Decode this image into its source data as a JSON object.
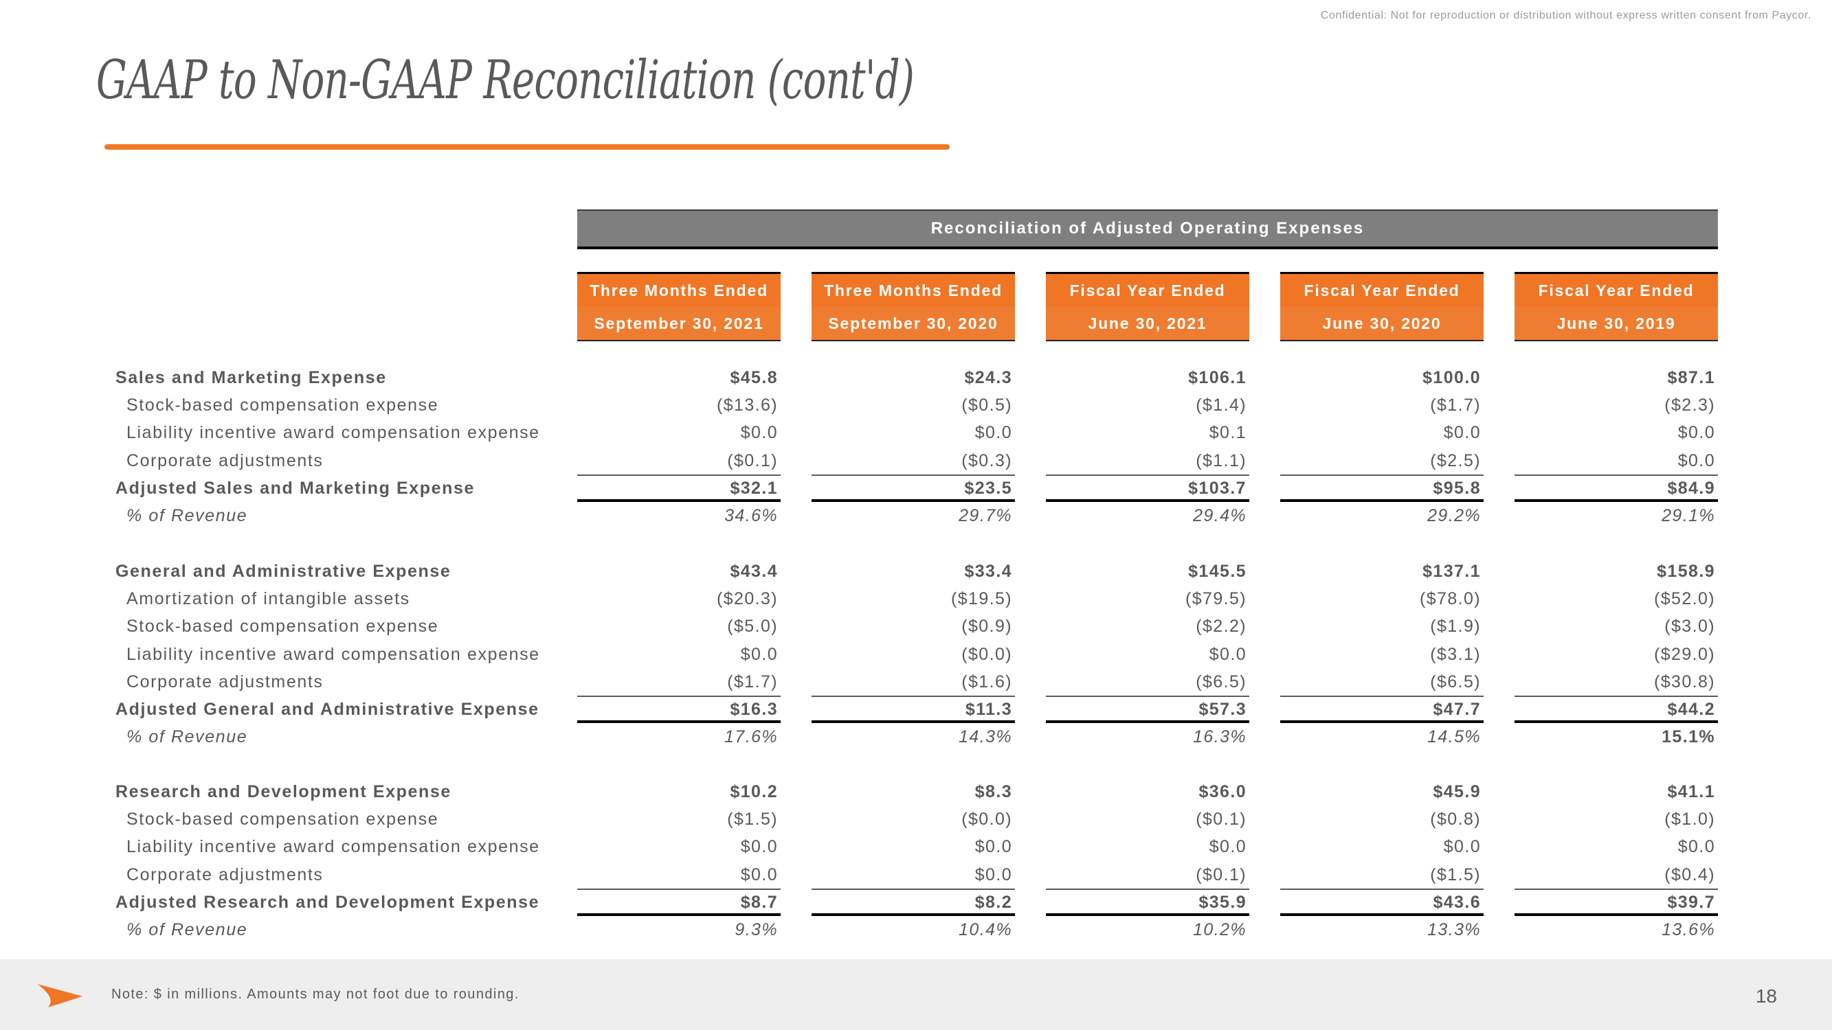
{
  "header": {
    "confidential": "Confidential: Not for reproduction or distribution without express written consent from Paycor.",
    "title": "GAAP to Non-GAAP Reconciliation (cont'd)"
  },
  "table": {
    "banner": "Reconciliation of Adjusted Operating Expenses",
    "columns": [
      {
        "line1": "Three Months Ended",
        "line2": "September 30, 2021"
      },
      {
        "line1": "Three Months Ended",
        "line2": "September 30, 2020"
      },
      {
        "line1": "Fiscal Year Ended",
        "line2": "June 30, 2021"
      },
      {
        "line1": "Fiscal Year Ended",
        "line2": "June 30, 2020"
      },
      {
        "line1": "Fiscal Year Ended",
        "line2": "June 30, 2019"
      }
    ],
    "sections": [
      {
        "rows": [
          {
            "label": "Sales and Marketing Expense",
            "style": "bold",
            "values": [
              "$45.8",
              "$24.3",
              "$106.1",
              "$100.0",
              "$87.1"
            ]
          },
          {
            "label": "Stock-based compensation expense",
            "style": "sub",
            "values": [
              "($13.6)",
              "($0.5)",
              "($1.4)",
              "($1.7)",
              "($2.3)"
            ]
          },
          {
            "label": "Liability incentive award compensation expense",
            "style": "sub",
            "values": [
              "$0.0",
              "$0.0",
              "$0.1",
              "$0.0",
              "$0.0"
            ]
          },
          {
            "label": "Corporate adjustments",
            "style": "sub",
            "values": [
              "($0.1)",
              "($0.3)",
              "($1.1)",
              "($2.5)",
              "$0.0"
            ]
          },
          {
            "label": "Adjusted Sales and Marketing Expense",
            "style": "total",
            "values": [
              "$32.1",
              "$23.5",
              "$103.7",
              "$95.8",
              "$84.9"
            ]
          },
          {
            "label": "% of Revenue",
            "style": "pct",
            "values": [
              "34.6%",
              "29.7%",
              "29.4%",
              "29.2%",
              "29.1%"
            ]
          }
        ]
      },
      {
        "rows": [
          {
            "label": "General and Administrative Expense",
            "style": "bold",
            "values": [
              "$43.4",
              "$33.4",
              "$145.5",
              "$137.1",
              "$158.9"
            ]
          },
          {
            "label": "Amortization of intangible assets",
            "style": "sub",
            "values": [
              "($20.3)",
              "($19.5)",
              "($79.5)",
              "($78.0)",
              "($52.0)"
            ]
          },
          {
            "label": "Stock-based compensation expense",
            "style": "sub",
            "values": [
              "($5.0)",
              "($0.9)",
              "($2.2)",
              "($1.9)",
              "($3.0)"
            ]
          },
          {
            "label": "Liability incentive award compensation expense",
            "style": "sub",
            "values": [
              "$0.0",
              "($0.0)",
              "$0.0",
              "($3.1)",
              "($29.0)"
            ]
          },
          {
            "label": "Corporate adjustments",
            "style": "sub",
            "values": [
              "($1.7)",
              "($1.6)",
              "($6.5)",
              "($6.5)",
              "($30.8)"
            ]
          },
          {
            "label": "Adjusted General and Administrative Expense",
            "style": "total",
            "values": [
              "$16.3",
              "$11.3",
              "$57.3",
              "$47.7",
              "$44.2"
            ]
          },
          {
            "label": "% of Revenue",
            "style": "pct",
            "values": [
              "17.6%",
              "14.3%",
              "16.3%",
              "14.5%",
              "15.1%"
            ],
            "bold_last": true
          }
        ]
      },
      {
        "rows": [
          {
            "label": "Research and Development Expense",
            "style": "bold",
            "values": [
              "$10.2",
              "$8.3",
              "$36.0",
              "$45.9",
              "$41.1"
            ]
          },
          {
            "label": "Stock-based compensation expense",
            "style": "sub",
            "values": [
              "($1.5)",
              "($0.0)",
              "($0.1)",
              "($0.8)",
              "($1.0)"
            ]
          },
          {
            "label": "Liability incentive award compensation expense",
            "style": "sub",
            "values": [
              "$0.0",
              "$0.0",
              "$0.0",
              "$0.0",
              "$0.0"
            ]
          },
          {
            "label": "Corporate adjustments",
            "style": "sub",
            "values": [
              "$0.0",
              "$0.0",
              "($0.1)",
              "($1.5)",
              "($0.4)"
            ]
          },
          {
            "label": "Adjusted Research and Development Expense",
            "style": "total",
            "values": [
              "$8.7",
              "$8.2",
              "$35.9",
              "$43.6",
              "$39.7"
            ]
          },
          {
            "label": "% of Revenue",
            "style": "pct",
            "values": [
              "9.3%",
              "10.4%",
              "10.2%",
              "13.3%",
              "13.6%"
            ]
          }
        ]
      }
    ]
  },
  "footer": {
    "logo_icon": "paycor-arrow-icon",
    "note": "Note: $ in millions. Amounts may not foot due to rounding.",
    "page_number": "18"
  },
  "colors": {
    "accent_orange": "#f07525",
    "banner_gray": "#7f7f7f",
    "text_gray": "#595959",
    "footer_bg": "#eeeeee"
  }
}
